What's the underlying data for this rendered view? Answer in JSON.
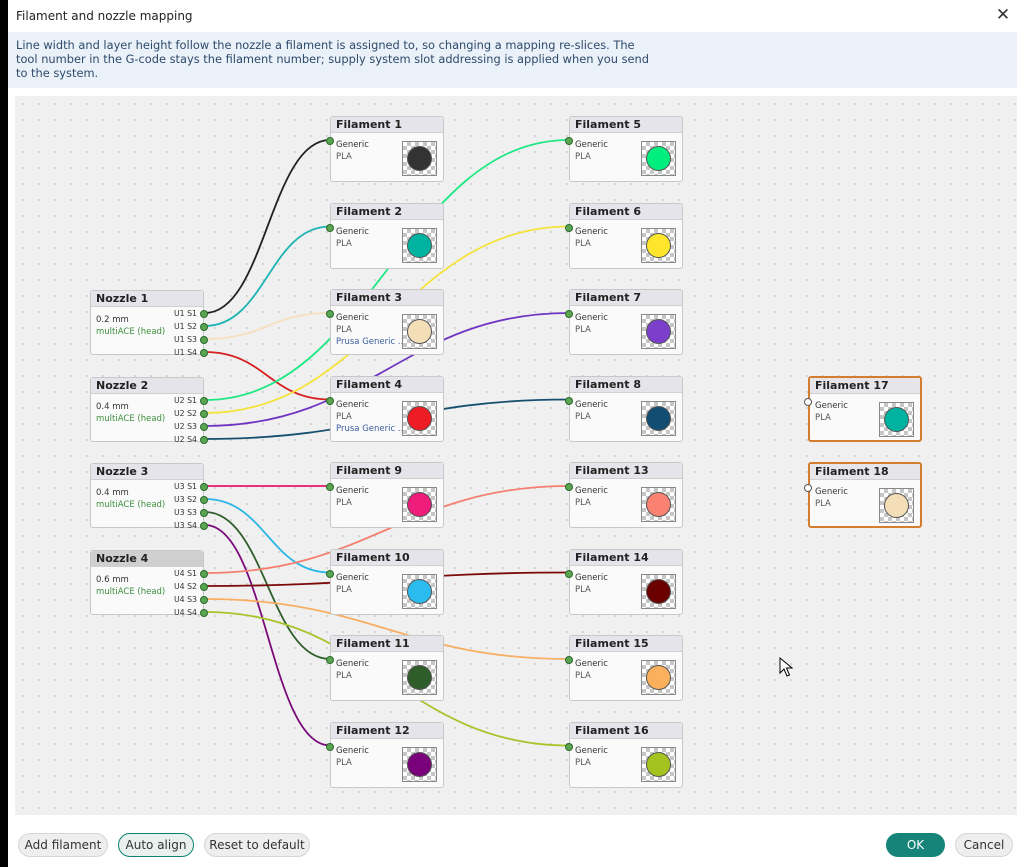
{
  "window": {
    "title": "Filament and nozzle mapping",
    "close_label": "✕"
  },
  "info": {
    "text": "Line width and layer height follow the nozzle a filament is assigned to, so changing a mapping re-slices. The tool number in the G-code stays the filament number; supply system slot addressing is applied when you send to the system."
  },
  "nozzles": [
    {
      "title": "Nozzle 1",
      "size": "0.2 mm",
      "source": "multiACE (head)",
      "ports": [
        "U1 S1",
        "U1 S2",
        "U1 S3",
        "U1 S4"
      ]
    },
    {
      "title": "Nozzle 2",
      "size": "0.4 mm",
      "source": "multiACE (head)",
      "ports": [
        "U2 S1",
        "U2 S2",
        "U2 S3",
        "U2 S4"
      ]
    },
    {
      "title": "Nozzle 3",
      "size": "0.4 mm",
      "source": "multiACE (head)",
      "ports": [
        "U3 S1",
        "U3 S2",
        "U3 S3",
        "U3 S4"
      ]
    },
    {
      "title": "Nozzle 4",
      "size": "0.6 mm",
      "source": "multiACE (head)",
      "ports": [
        "U4 S1",
        "U4 S2",
        "U4 S3",
        "U4 S4"
      ]
    }
  ],
  "filaments": [
    {
      "title": "Filament 1",
      "vendor": "Generic",
      "material": "PLA",
      "profile": "",
      "color": "#333333"
    },
    {
      "title": "Filament 2",
      "vendor": "Generic",
      "material": "PLA",
      "profile": "",
      "color": "#00b2a0"
    },
    {
      "title": "Filament 3",
      "vendor": "Generic",
      "material": "PLA",
      "profile": "Prusa Generic ...",
      "color": "#f3deb8"
    },
    {
      "title": "Filament 4",
      "vendor": "Generic",
      "material": "PLA",
      "profile": "Prusa Generic ...",
      "color": "#ee1c25"
    },
    {
      "title": "Filament 5",
      "vendor": "Generic",
      "material": "PLA",
      "profile": "",
      "color": "#00ee7d"
    },
    {
      "title": "Filament 6",
      "vendor": "Generic",
      "material": "PLA",
      "profile": "",
      "color": "#fde62c"
    },
    {
      "title": "Filament 7",
      "vendor": "Generic",
      "material": "PLA",
      "profile": "",
      "color": "#7b3fcc"
    },
    {
      "title": "Filament 8",
      "vendor": "Generic",
      "material": "PLA",
      "profile": "",
      "color": "#124d72"
    },
    {
      "title": "Filament 9",
      "vendor": "Generic",
      "material": "PLA",
      "profile": "",
      "color": "#ee1c7a"
    },
    {
      "title": "Filament 10",
      "vendor": "Generic",
      "material": "PLA",
      "profile": "",
      "color": "#2cbbee"
    },
    {
      "title": "Filament 11",
      "vendor": "Generic",
      "material": "PLA",
      "profile": "",
      "color": "#2e5d2a"
    },
    {
      "title": "Filament 12",
      "vendor": "Generic",
      "material": "PLA",
      "profile": "",
      "color": "#7b007b"
    },
    {
      "title": "Filament 13",
      "vendor": "Generic",
      "material": "PLA",
      "profile": "",
      "color": "#f98273"
    },
    {
      "title": "Filament 14",
      "vendor": "Generic",
      "material": "PLA",
      "profile": "",
      "color": "#6b0000"
    },
    {
      "title": "Filament 15",
      "vendor": "Generic",
      "material": "PLA",
      "profile": "",
      "color": "#fbb05d"
    },
    {
      "title": "Filament 16",
      "vendor": "Generic",
      "material": "PLA",
      "profile": "",
      "color": "#a5c31f"
    },
    {
      "title": "Filament 17",
      "vendor": "Generic",
      "material": "PLA",
      "profile": "",
      "color": "#00b2a0"
    },
    {
      "title": "Filament 18",
      "vendor": "Generic",
      "material": "PLA",
      "profile": "",
      "color": "#f3deb8"
    }
  ],
  "links": [
    {
      "nozzle": 1,
      "slot": 1,
      "filament": 1,
      "color": "#222222"
    },
    {
      "nozzle": 1,
      "slot": 2,
      "filament": 2,
      "color": "#1bb3b3"
    },
    {
      "nozzle": 1,
      "slot": 3,
      "filament": 3,
      "color": "#f6dfbd"
    },
    {
      "nozzle": 1,
      "slot": 4,
      "filament": 4,
      "color": "#d61f1f"
    },
    {
      "nozzle": 2,
      "slot": 1,
      "filament": 5,
      "color": "#1fe882"
    },
    {
      "nozzle": 2,
      "slot": 2,
      "filament": 6,
      "color": "#f5e23a"
    },
    {
      "nozzle": 2,
      "slot": 3,
      "filament": 7,
      "color": "#6f35c2"
    },
    {
      "nozzle": 2,
      "slot": 4,
      "filament": 8,
      "color": "#16506e"
    },
    {
      "nozzle": 3,
      "slot": 1,
      "filament": 9,
      "color": "#e3186f"
    },
    {
      "nozzle": 3,
      "slot": 2,
      "filament": 10,
      "color": "#2cb6e6"
    },
    {
      "nozzle": 3,
      "slot": 3,
      "filament": 11,
      "color": "#2e5d2a"
    },
    {
      "nozzle": 3,
      "slot": 4,
      "filament": 12,
      "color": "#7a0a7a"
    },
    {
      "nozzle": 4,
      "slot": 1,
      "filament": 13,
      "color": "#f57f70"
    },
    {
      "nozzle": 4,
      "slot": 2,
      "filament": 14,
      "color": "#7a0a0a"
    },
    {
      "nozzle": 4,
      "slot": 3,
      "filament": 15,
      "color": "#f7ae62"
    },
    {
      "nozzle": 4,
      "slot": 4,
      "filament": 16,
      "color": "#a8c42c"
    }
  ],
  "buttons": {
    "add_filament": "Add filament",
    "auto_align": "Auto align",
    "reset": "Reset to default",
    "ok": "OK",
    "cancel": "Cancel"
  }
}
